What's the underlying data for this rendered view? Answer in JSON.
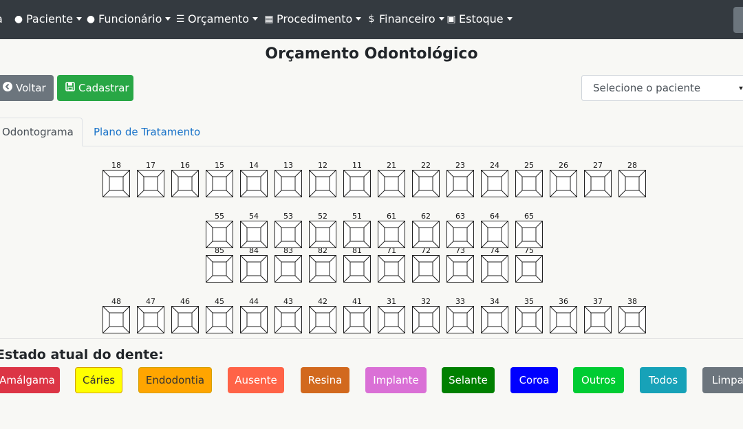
{
  "navbar": {
    "brand": "a",
    "items": [
      {
        "label": "Paciente",
        "icon": "user-icon"
      },
      {
        "label": "Funcionário",
        "icon": "user-tie-icon"
      },
      {
        "label": "Orçamento",
        "icon": "list-icon"
      },
      {
        "label": "Procedimento",
        "icon": "table-icon"
      },
      {
        "label": "Financeiro",
        "icon": "dollar-icon"
      },
      {
        "label": "Estoque",
        "icon": "box-icon"
      }
    ]
  },
  "page": {
    "title": "Orçamento Odontológico"
  },
  "actions": {
    "back_label": "Voltar",
    "save_label": "Cadastrar"
  },
  "patient_select": {
    "selected": "Selecione o paciente"
  },
  "tabs": [
    {
      "label": "Odontograma",
      "active": true
    },
    {
      "label": "Plano de Tratamento",
      "active": false
    }
  ],
  "odontogram": {
    "upper_permanent": [
      "18",
      "17",
      "16",
      "15",
      "14",
      "13",
      "12",
      "11",
      "21",
      "22",
      "23",
      "24",
      "25",
      "26",
      "27",
      "28"
    ],
    "upper_deciduous": [
      "55",
      "54",
      "53",
      "52",
      "51",
      "61",
      "62",
      "63",
      "64",
      "65"
    ],
    "lower_deciduous": [
      "85",
      "84",
      "83",
      "82",
      "81",
      "71",
      "72",
      "73",
      "74",
      "75"
    ],
    "lower_permanent": [
      "48",
      "47",
      "46",
      "45",
      "44",
      "43",
      "42",
      "41",
      "31",
      "32",
      "33",
      "34",
      "35",
      "36",
      "37",
      "38"
    ]
  },
  "legend": {
    "title": "Estado atual do dente:",
    "buttons": [
      {
        "label": "Amálgama",
        "bg": "#dc3545",
        "fg": "#ffffff"
      },
      {
        "label": "Cáries",
        "bg": "#ffff00",
        "fg": "#333333"
      },
      {
        "label": "Endodontia",
        "bg": "#ffa500",
        "fg": "#333333"
      },
      {
        "label": "Ausente",
        "bg": "#ff6347",
        "fg": "#ffffff"
      },
      {
        "label": "Resina",
        "bg": "#d2691e",
        "fg": "#ffffff"
      },
      {
        "label": "Implante",
        "bg": "#da70d6",
        "fg": "#ffffff"
      },
      {
        "label": "Selante",
        "bg": "#008000",
        "fg": "#ffffff"
      },
      {
        "label": "Coroa",
        "bg": "#0000ff",
        "fg": "#ffffff"
      },
      {
        "label": "Outros",
        "bg": "#00cc33",
        "fg": "#ffffff"
      },
      {
        "label": "Todos",
        "bg": "#17a2b8",
        "fg": "#ffffff"
      },
      {
        "label": "Limpar",
        "bg": "#6c757d",
        "fg": "#ffffff"
      }
    ]
  }
}
